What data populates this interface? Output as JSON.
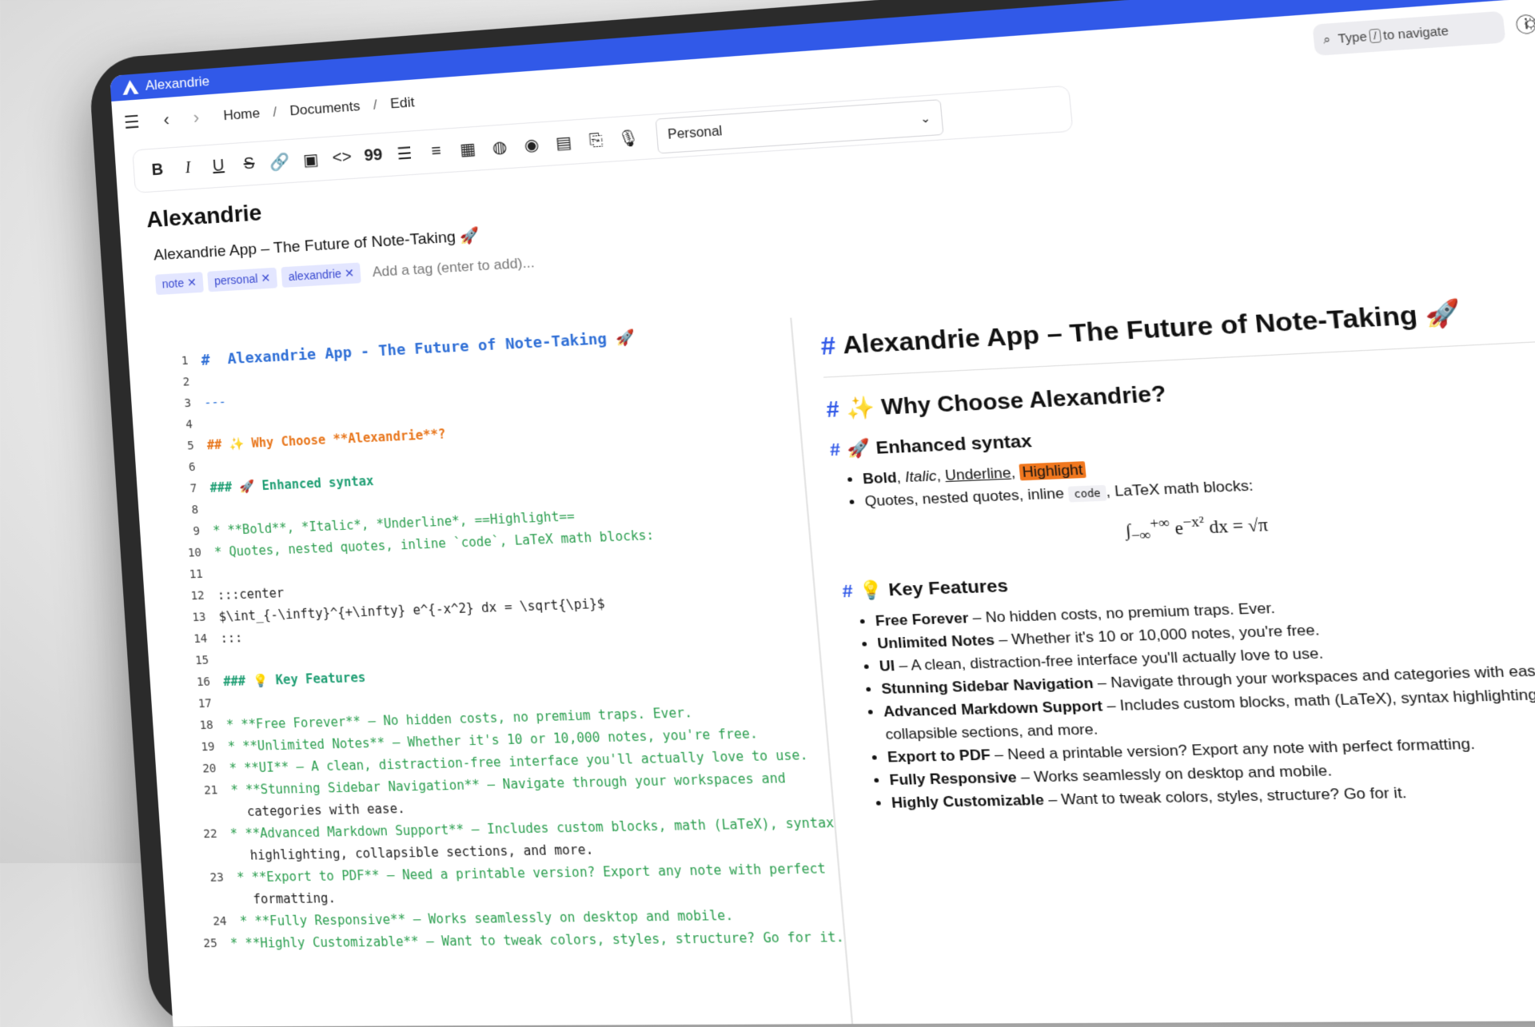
{
  "app": {
    "title": "Alexandrie"
  },
  "window": {
    "controls": [
      "puzzle-icon",
      "kebab-icon",
      "minimize-icon",
      "maximize-icon",
      "close-icon"
    ]
  },
  "search": {
    "prefix": "Type",
    "key": "/",
    "suffix": "to navigate"
  },
  "breadcrumb": [
    "Home",
    "Documents",
    "Edit"
  ],
  "toolbar": {
    "buttons": [
      "B",
      "I",
      "U",
      "S",
      "link",
      "image",
      "<>",
      "99",
      "list",
      "ordered-list",
      "table",
      "palette",
      "preview",
      "save",
      "export",
      "mic"
    ],
    "workspace": "Personal"
  },
  "document": {
    "category": "Alexandrie",
    "title": "Alexandrie App – The Future of Note-Taking 🚀",
    "tags": [
      "note",
      "personal",
      "alexandrie"
    ],
    "tag_placeholder": "Add a tag (enter to add)..."
  },
  "editor": {
    "lines": [
      {
        "n": "1",
        "text": "#  Alexandrie App - The Future of Note-Taking 🚀",
        "style": "h1"
      },
      {
        "n": "2",
        "text": "",
        "style": ""
      },
      {
        "n": "3",
        "text": "---",
        "style": "hr"
      },
      {
        "n": "4",
        "text": "",
        "style": ""
      },
      {
        "n": "5",
        "text": "## ✨ Why Choose **Alexandrie**?",
        "style": "h2"
      },
      {
        "n": "6",
        "text": "",
        "style": ""
      },
      {
        "n": "7",
        "text": "### 🚀 Enhanced syntax",
        "style": "h3"
      },
      {
        "n": "8",
        "text": "",
        "style": ""
      },
      {
        "n": "9",
        "text": "* **Bold**, *Italic*, *Underline*, ==Highlight==",
        "style": "bullet"
      },
      {
        "n": "10",
        "text": "* Quotes, nested quotes, inline `code`, LaTeX math blocks:",
        "style": "bullet"
      },
      {
        "n": "11",
        "text": "",
        "style": ""
      },
      {
        "n": "12",
        "text": ":::center",
        "style": ""
      },
      {
        "n": "13",
        "text": "$\\int_{-\\infty}^{+\\infty} e^{-x^2} dx = \\sqrt{\\pi}$",
        "style": ""
      },
      {
        "n": "14",
        "text": ":::",
        "style": ""
      },
      {
        "n": "15",
        "text": "",
        "style": ""
      },
      {
        "n": "16",
        "text": "### 💡 Key Features",
        "style": "h3"
      },
      {
        "n": "17",
        "text": "",
        "style": ""
      },
      {
        "n": "18",
        "text": "* **Free Forever** – No hidden costs, no premium traps. Ever.",
        "style": "bullet"
      },
      {
        "n": "19",
        "text": "* **Unlimited Notes** – Whether it's 10 or 10,000 notes, you're free.",
        "style": "bullet"
      },
      {
        "n": "20",
        "text": "* **UI** – A clean, distraction-free interface you'll actually love to use.",
        "style": "bullet"
      },
      {
        "n": "21",
        "text": "* **Stunning Sidebar Navigation** – Navigate through your workspaces and",
        "style": "bullet"
      },
      {
        "n": "",
        "text": "  categories with ease.",
        "style": ""
      },
      {
        "n": "22",
        "text": "* **Advanced Markdown Support** – Includes custom blocks, math (LaTeX), syntax",
        "style": "bullet"
      },
      {
        "n": "",
        "text": "  highlighting, collapsible sections, and more.",
        "style": ""
      },
      {
        "n": "23",
        "text": "* **Export to PDF** – Need a printable version? Export any note with perfect",
        "style": "bullet"
      },
      {
        "n": "",
        "text": "  formatting.",
        "style": ""
      },
      {
        "n": "24",
        "text": "* **Fully Responsive** – Works seamlessly on desktop and mobile.",
        "style": "bullet"
      },
      {
        "n": "25",
        "text": "* **Highly Customizable** – Want to tweak colors, styles, structure? Go for it.",
        "style": "bullet"
      }
    ]
  },
  "preview": {
    "h1": "Alexandrie App – The Future of Note-Taking 🚀",
    "h2": "✨ Why Choose Alexandrie?",
    "syntax_heading": "🚀 Enhanced syntax",
    "syntax_bold": "Bold",
    "syntax_italic": "Italic",
    "syntax_underline": "Underline",
    "syntax_highlight": "Highlight",
    "syntax_line2_a": "Quotes, nested quotes, inline",
    "syntax_code": "code",
    "syntax_line2_b": ", LaTeX math blocks:",
    "features_heading": "💡 Key Features",
    "features": [
      {
        "name": "Free Forever",
        "desc": " – No hidden costs, no premium traps. Ever."
      },
      {
        "name": "Unlimited Notes",
        "desc": " – Whether it's 10 or 10,000 notes, you're free."
      },
      {
        "name": "UI",
        "desc": " – A clean, distraction-free interface you'll actually love to use."
      },
      {
        "name": "Stunning Sidebar Navigation",
        "desc": " – Navigate through your workspaces and categories with ease."
      },
      {
        "name": "Advanced Markdown Support",
        "desc": " – Includes custom blocks, math (LaTeX), syntax highlighting, collapsible sections, and more."
      },
      {
        "name": "Export to PDF",
        "desc": " – Need a printable version? Export any note with perfect formatting."
      },
      {
        "name": "Fully Responsive",
        "desc": " – Works seamlessly on desktop and mobile."
      },
      {
        "name": "Highly Customizable",
        "desc": " – Want to tweak colors, styles, structure? Go for it."
      }
    ]
  }
}
